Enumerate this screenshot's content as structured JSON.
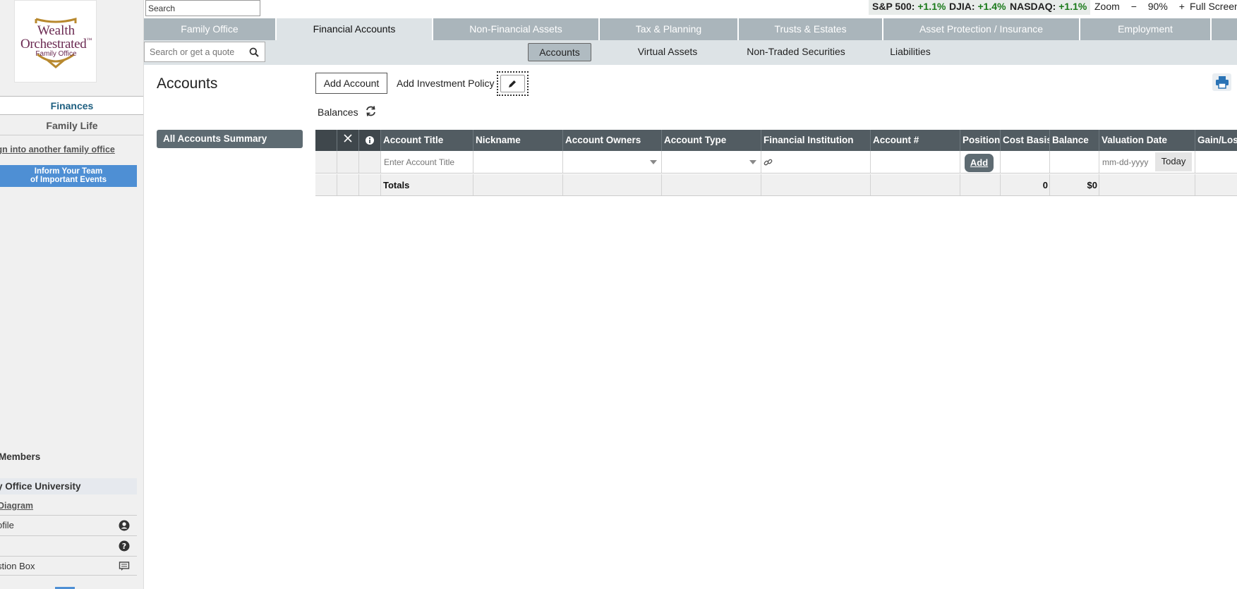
{
  "sidebar": {
    "logo_line1": "Wealth",
    "logo_line2": "Orchestrated",
    "logo_tm": "™",
    "logo_sub": "Family Office",
    "tab_active": "Finances",
    "tab_inactive": "Family Life",
    "signin_link": "ign into another family office",
    "inform_line1": "Inform Your Team",
    "inform_line2": "of Important Events",
    "members": "Members",
    "university": "y Office University",
    "diagram": "Diagram",
    "profile": "ofile",
    "suggestion": "stion Box",
    "help_label": ""
  },
  "topbar": {
    "search_value": "Search",
    "tickers": [
      {
        "name": "S&P 500:",
        "change": "+1.1%"
      },
      {
        "name": "DJIA:",
        "change": "+1.4%"
      },
      {
        "name": "NASDAQ:",
        "change": "+1.1%"
      }
    ],
    "zoom_label": "Zoom",
    "zoom_minus": "−",
    "zoom_value": "90%",
    "zoom_plus": "+",
    "fullscreen": "Full Screen"
  },
  "mainnav": [
    {
      "label": "Family Office"
    },
    {
      "label": "Financial Accounts"
    },
    {
      "label": "Non-Financial Assets"
    },
    {
      "label": "Tax & Planning"
    },
    {
      "label": "Trusts & Estates"
    },
    {
      "label": "Asset Protection / Insurance"
    },
    {
      "label": "Employment"
    }
  ],
  "subnav": {
    "search_placeholder": "Search or get a quote",
    "tabs": [
      {
        "label": "Accounts"
      },
      {
        "label": "Virtual Assets"
      },
      {
        "label": "Non-Traded Securities"
      },
      {
        "label": "Liabilities"
      }
    ]
  },
  "content": {
    "title": "Accounts",
    "add_account": "Add Account",
    "add_policy": "Add Investment Policy",
    "balances": "Balances",
    "summary_button": "All Accounts Summary"
  },
  "table": {
    "headers": [
      "Account Title",
      "Nickname",
      "Account Owners",
      "Account Type",
      "Financial Institution",
      "Account #",
      "Positions",
      "Cost Basis",
      "Balance",
      "Valuation Date",
      "Gain/Loss"
    ],
    "title_placeholder": "Enter Account Title",
    "positions_add": "Add",
    "date_placeholder": "mm-dd-yyyy",
    "today": "Today",
    "totals_label": "Totals",
    "totals_cost_basis": "0",
    "totals_balance": "$0"
  },
  "colors": {
    "accent_blue": "#4e8fd4",
    "nav_grey": "#aab5bb",
    "header_dark": "#525c62",
    "ticker_green": "#1a7a1a",
    "brand_plum": "#6b2a52"
  }
}
